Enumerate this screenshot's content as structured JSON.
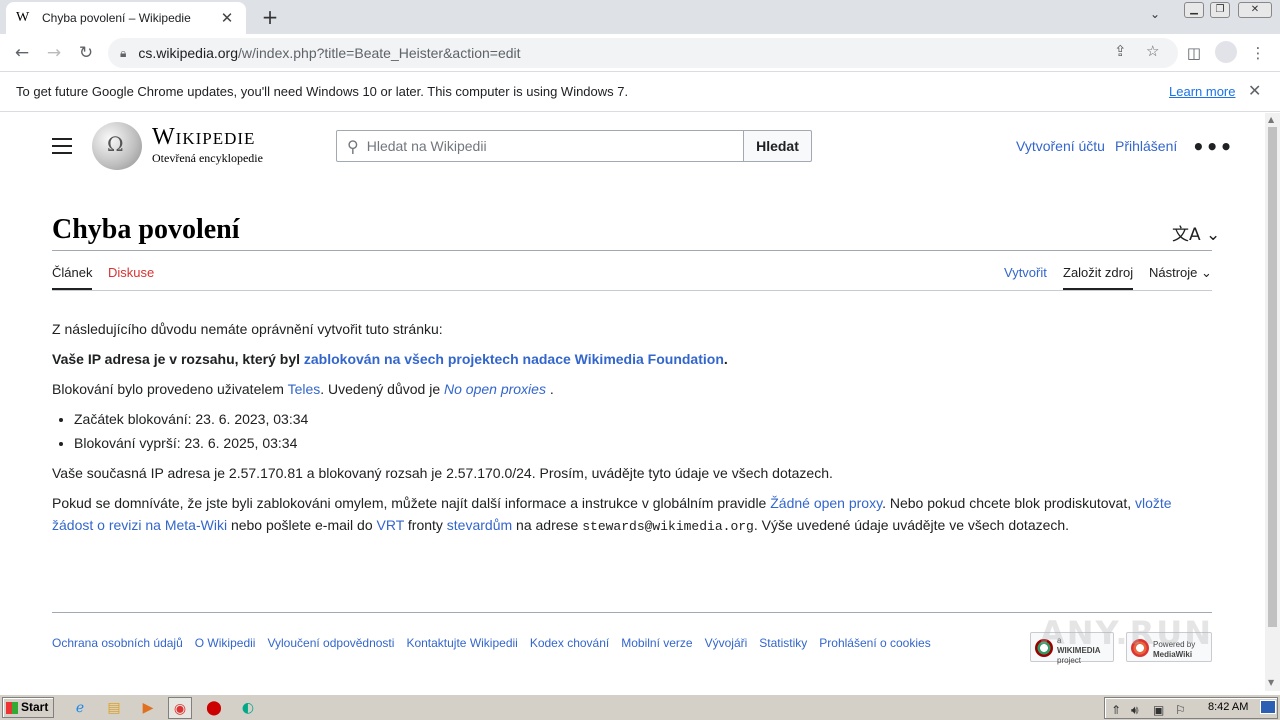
{
  "browser": {
    "tab_title": "Chyba povolení – Wikipedie",
    "tab_favicon": "W",
    "url_host": "cs.wikipedia.org",
    "url_path": "/w/index.php?title=Beate_Heister&action=edit"
  },
  "infobar": {
    "message": "To get future Google Chrome updates, you'll need Windows 10 or later. This computer is using Windows 7.",
    "learn_more": "Learn more"
  },
  "wiki": {
    "wordmark": "Wikipedie",
    "tagline": "Otevřená encyklopedie",
    "search_placeholder": "Hledat na Wikipedii",
    "search_button": "Hledat",
    "create_account": "Vytvoření účtu",
    "login": "Přihlášení"
  },
  "page": {
    "title": "Chyba povolení",
    "tabs_left": [
      "Článek",
      "Diskuse"
    ],
    "tabs_right": [
      "Vytvořit",
      "Založit zdroj",
      "Nástroje"
    ]
  },
  "content": {
    "intro": "Z následujícího důvodu nemáte oprávnění vytvořit tuto stránku:",
    "ip_range_prefix": "Vaše IP adresa je v rozsahu, který byl ",
    "ip_range_link": "zablokován na všech projektech nadace Wikimedia Foundation",
    "ip_range_suffix": ".",
    "blocked_by_prefix": "Blokování bylo provedeno uživatelem ",
    "blocked_by_user": "Teles",
    "blocked_by_middle": ". Uvedený důvod je ",
    "blocked_reason": "No open proxies",
    "blocked_by_suffix": " .",
    "block_start": "Začátek blokování: 23. 6. 2023, 03:34",
    "block_expires": "Blokování vyprší: 23. 6. 2025, 03:34",
    "current_ip": "Vaše současná IP adresa je 2.57.170.81 a blokovaný rozsah je 2.57.170.0/24. Prosím, uvádějte tyto údaje ve všech dotazech.",
    "appeal_1": "Pokud se domníváte, že jste byli zablokováni omylem, můžete najít další informace a instrukce v globálním pravidle ",
    "appeal_link_1": "Žádné open proxy",
    "appeal_2": ". Nebo pokud chcete blok prodiskutovat, ",
    "appeal_link_2": "vložte žádost o revizi na Meta-Wiki",
    "appeal_3": " nebo pošlete e-mail do ",
    "appeal_link_3": "VRT",
    "appeal_4": " fronty ",
    "appeal_link_4": "stevardům",
    "appeal_5": " na adrese ",
    "appeal_email": "stewards@wikimedia.org",
    "appeal_6": ". Výše uvedené údaje uvádějte ve všech dotazech."
  },
  "footer": {
    "links": [
      "Ochrana osobních údajů",
      "O Wikipedii",
      "Vyloučení odpovědnosti",
      "Kontaktujte Wikipedii",
      "Kodex chování",
      "Mobilní verze",
      "Vývojáři",
      "Statistiky",
      "Prohlášení o cookies"
    ],
    "badge_wikimedia_small": "a",
    "badge_wikimedia": "WIKIMEDIA",
    "badge_wikimedia_sub": "project",
    "badge_mw_top": "Powered by",
    "badge_mw": "MediaWiki",
    "watermark": "ANY.RUN"
  },
  "taskbar": {
    "start": "Start",
    "clock": "8:42 AM"
  }
}
